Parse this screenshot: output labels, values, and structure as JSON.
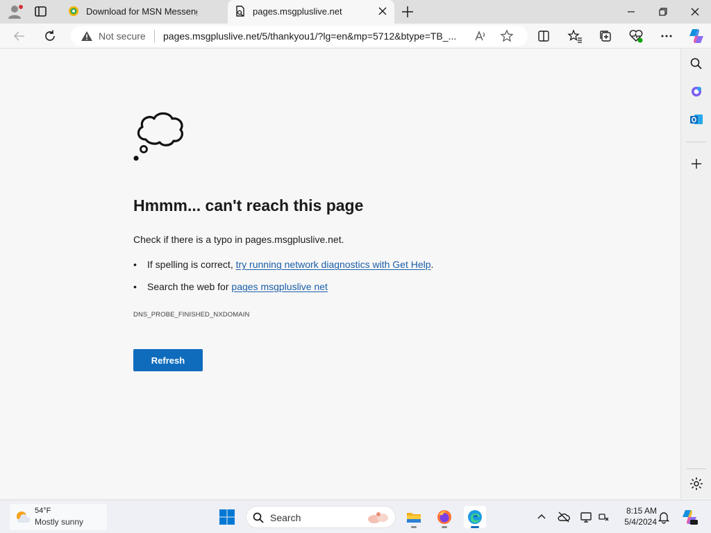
{
  "browser": {
    "tabs": [
      {
        "title": "Download for MSN Messenger |",
        "active": false,
        "favicon": "msgplus-favicon"
      },
      {
        "title": "pages.msgpluslive.net",
        "active": true,
        "favicon": "page-error-favicon"
      }
    ],
    "address_bar": {
      "security_label": "Not secure",
      "url": "pages.msgpluslive.net/5/thankyou1/?lg=en&mp=5712&btype=TB_..."
    }
  },
  "error_page": {
    "heading": "Hmmm... can't reach this page",
    "check_text": "Check if there is a typo in pages.msgpluslive.net.",
    "bullet1_prefix": "If spelling is correct, ",
    "bullet1_link": "try running network diagnostics with Get Help",
    "bullet1_suffix": ".",
    "bullet2_prefix": "Search the web for ",
    "bullet2_link": "pages msgpluslive net",
    "error_code": "DNS_PROBE_FINISHED_NXDOMAIN",
    "refresh_label": "Refresh"
  },
  "taskbar": {
    "weather_temp": "54°F",
    "weather_condition": "Mostly sunny",
    "search_placeholder": "Search",
    "time": "8:15 AM",
    "date": "5/4/2024"
  },
  "colors": {
    "accent": "#0f6cbd",
    "link": "#1a5ea8",
    "page_bg": "#f7f7f7"
  }
}
